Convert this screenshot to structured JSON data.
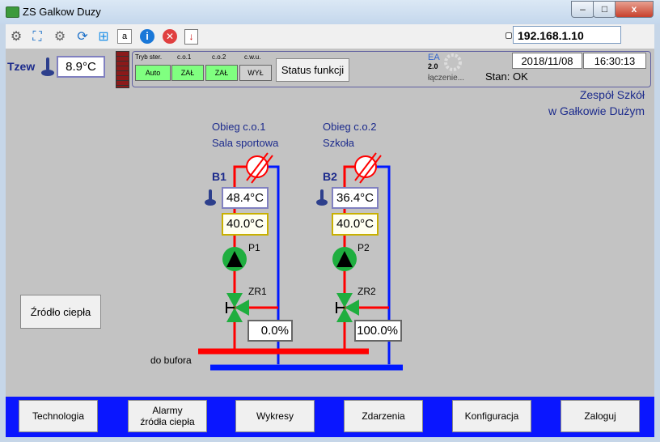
{
  "window": {
    "title": "ZS Galkow Duzy",
    "min": "–",
    "max": "□",
    "close": "x"
  },
  "toolbar": {
    "ip": "192.168.1.10"
  },
  "status": {
    "tzew_label": "Tzew",
    "tzew_value": "8.9°C",
    "mode_header": "Tryb ster.",
    "co1_header": "c.o.1",
    "co2_header": "c.o.2",
    "cwu_header": "c.w.u.",
    "mode_value": "Auto",
    "co1_value": "ZAŁ",
    "co2_value": "ZAŁ",
    "cwu_value": "WYŁ",
    "status_button": "Status funkcji",
    "ea_label": "EA",
    "ea_version": "2.0",
    "connecting": "łączenie...",
    "date": "2018/11/08",
    "time": "16:30:13",
    "stan": "Stan: OK"
  },
  "site": {
    "line1": "Zespół Szkół",
    "line2": "w Gałkowie Dużym"
  },
  "circuits": [
    {
      "name1": "Obieg c.o.1",
      "name2": "Sala sportowa",
      "id": "B1",
      "temp": "48.4°C",
      "setpoint": "40.0°C",
      "pump": "P1",
      "valve": "ZR1",
      "valve_pos": "0.0%"
    },
    {
      "name1": "Obieg c.o.2",
      "name2": "Szkoła",
      "id": "B2",
      "temp": "36.4°C",
      "setpoint": "40.0°C",
      "pump": "P2",
      "valve": "ZR2",
      "valve_pos": "100.0%"
    }
  ],
  "buffer_label": "do bufora",
  "heat_source_button": "Źródło ciepła",
  "nav": [
    "Technologia",
    "Alarmy\nźródła ciepła",
    "Wykresy",
    "Zdarzenia",
    "Konfiguracja",
    "Zaloguj"
  ]
}
